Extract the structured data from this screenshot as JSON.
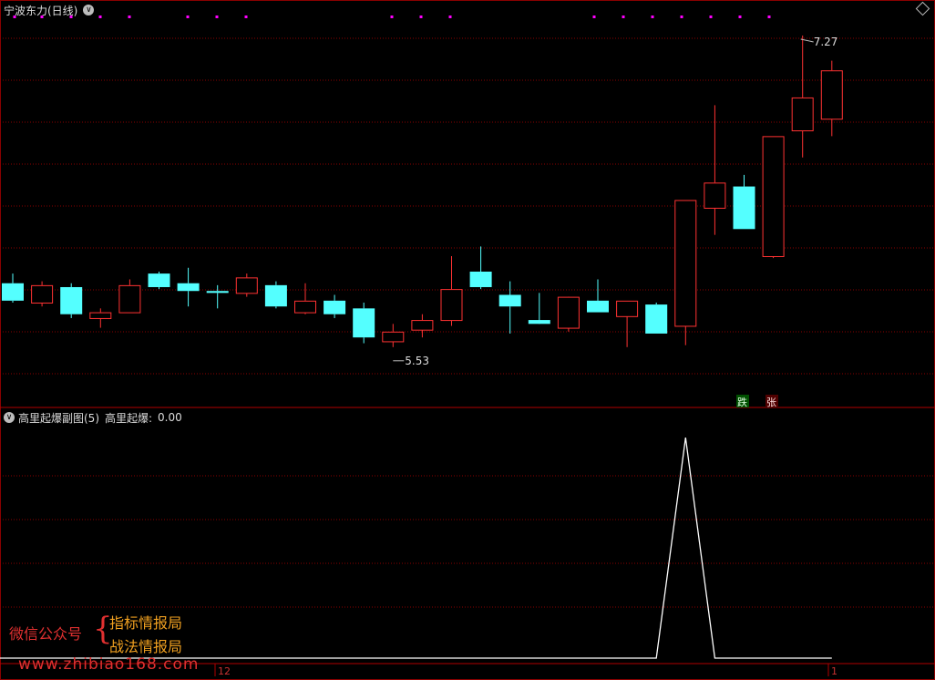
{
  "main_panel": {
    "title": "宁波东力(日线)",
    "high_label": "7.27",
    "low_label": "5.53"
  },
  "sub_panel": {
    "title": "高里起爆副图(5)",
    "indicator_label": "高里起爆:",
    "indicator_value": "0.00"
  },
  "axis": {
    "labels": [
      "12",
      "1"
    ]
  },
  "signals": {
    "down": "跌",
    "up": "张"
  },
  "watermark": {
    "left": "微信公众号",
    "line1": "指标情报局",
    "line2": "战法情报局",
    "site": "www.zhibiao168.com"
  },
  "colors": {
    "up": "#ff3232",
    "down": "#54ffff",
    "grid": "#8a0000",
    "marker": "#ff00ff",
    "line": "#ffffff"
  },
  "chart_data": [
    {
      "type": "candlestick",
      "title": "宁波东力(日线)",
      "ylim": [
        5.4,
        7.35
      ],
      "annotations": [
        {
          "label": "7.27",
          "type": "high"
        },
        {
          "label": "5.53",
          "type": "low"
        }
      ],
      "candles": [
        {
          "o": 5.99,
          "h": 6.04,
          "l": 5.89,
          "c": 5.9
        },
        {
          "o": 5.89,
          "h": 6.0,
          "l": 5.87,
          "c": 5.98
        },
        {
          "o": 5.97,
          "h": 5.99,
          "l": 5.81,
          "c": 5.83
        },
        {
          "o": 5.81,
          "h": 5.86,
          "l": 5.76,
          "c": 5.84
        },
        {
          "o": 5.84,
          "h": 6.01,
          "l": 5.84,
          "c": 5.98
        },
        {
          "o": 6.04,
          "h": 6.05,
          "l": 5.96,
          "c": 5.97
        },
        {
          "o": 5.99,
          "h": 6.07,
          "l": 5.87,
          "c": 5.95
        },
        {
          "o": 5.95,
          "h": 5.98,
          "l": 5.86,
          "c": 5.94
        },
        {
          "o": 5.94,
          "h": 6.04,
          "l": 5.92,
          "c": 6.02
        },
        {
          "o": 5.98,
          "h": 6.0,
          "l": 5.86,
          "c": 5.87
        },
        {
          "o": 5.84,
          "h": 5.99,
          "l": 5.83,
          "c": 5.9
        },
        {
          "o": 5.9,
          "h": 5.93,
          "l": 5.81,
          "c": 5.83
        },
        {
          "o": 5.86,
          "h": 5.89,
          "l": 5.68,
          "c": 5.71
        },
        {
          "o": 5.69,
          "h": 5.78,
          "l": 5.66,
          "c": 5.74
        },
        {
          "o": 5.75,
          "h": 5.83,
          "l": 5.71,
          "c": 5.8
        },
        {
          "o": 5.8,
          "h": 6.13,
          "l": 5.77,
          "c": 5.96
        },
        {
          "o": 6.05,
          "h": 6.18,
          "l": 5.96,
          "c": 5.97
        },
        {
          "o": 5.93,
          "h": 6.0,
          "l": 5.73,
          "c": 5.87
        },
        {
          "o": 5.8,
          "h": 5.94,
          "l": 5.8,
          "c": 5.78
        },
        {
          "o": 5.76,
          "h": 5.86,
          "l": 5.74,
          "c": 5.92
        },
        {
          "o": 5.9,
          "h": 6.01,
          "l": 5.84,
          "c": 5.84
        },
        {
          "o": 5.82,
          "h": 5.9,
          "l": 5.66,
          "c": 5.9
        },
        {
          "o": 5.88,
          "h": 5.89,
          "l": 5.73,
          "c": 5.73
        },
        {
          "o": 5.77,
          "h": 6.42,
          "l": 5.67,
          "c": 6.42
        },
        {
          "o": 6.38,
          "h": 6.91,
          "l": 6.24,
          "c": 6.51
        },
        {
          "o": 6.49,
          "h": 6.55,
          "l": 6.27,
          "c": 6.27
        },
        {
          "o": 6.13,
          "h": 6.75,
          "l": 6.12,
          "c": 6.75
        },
        {
          "o": 6.78,
          "h": 7.27,
          "l": 6.64,
          "c": 6.95
        },
        {
          "o": 6.84,
          "h": 7.14,
          "l": 6.75,
          "c": 7.09
        }
      ]
    },
    {
      "type": "line",
      "title": "高里起爆副图(5)",
      "series": [
        {
          "name": "高里起爆",
          "values": [
            0,
            0,
            0,
            0,
            0,
            0,
            0,
            0,
            0,
            0,
            0,
            0,
            0,
            0,
            0,
            0,
            0,
            0,
            0,
            0,
            0,
            0,
            0,
            1,
            0,
            0,
            0,
            0,
            0
          ]
        }
      ],
      "ylim": [
        0,
        1.05
      ]
    }
  ]
}
